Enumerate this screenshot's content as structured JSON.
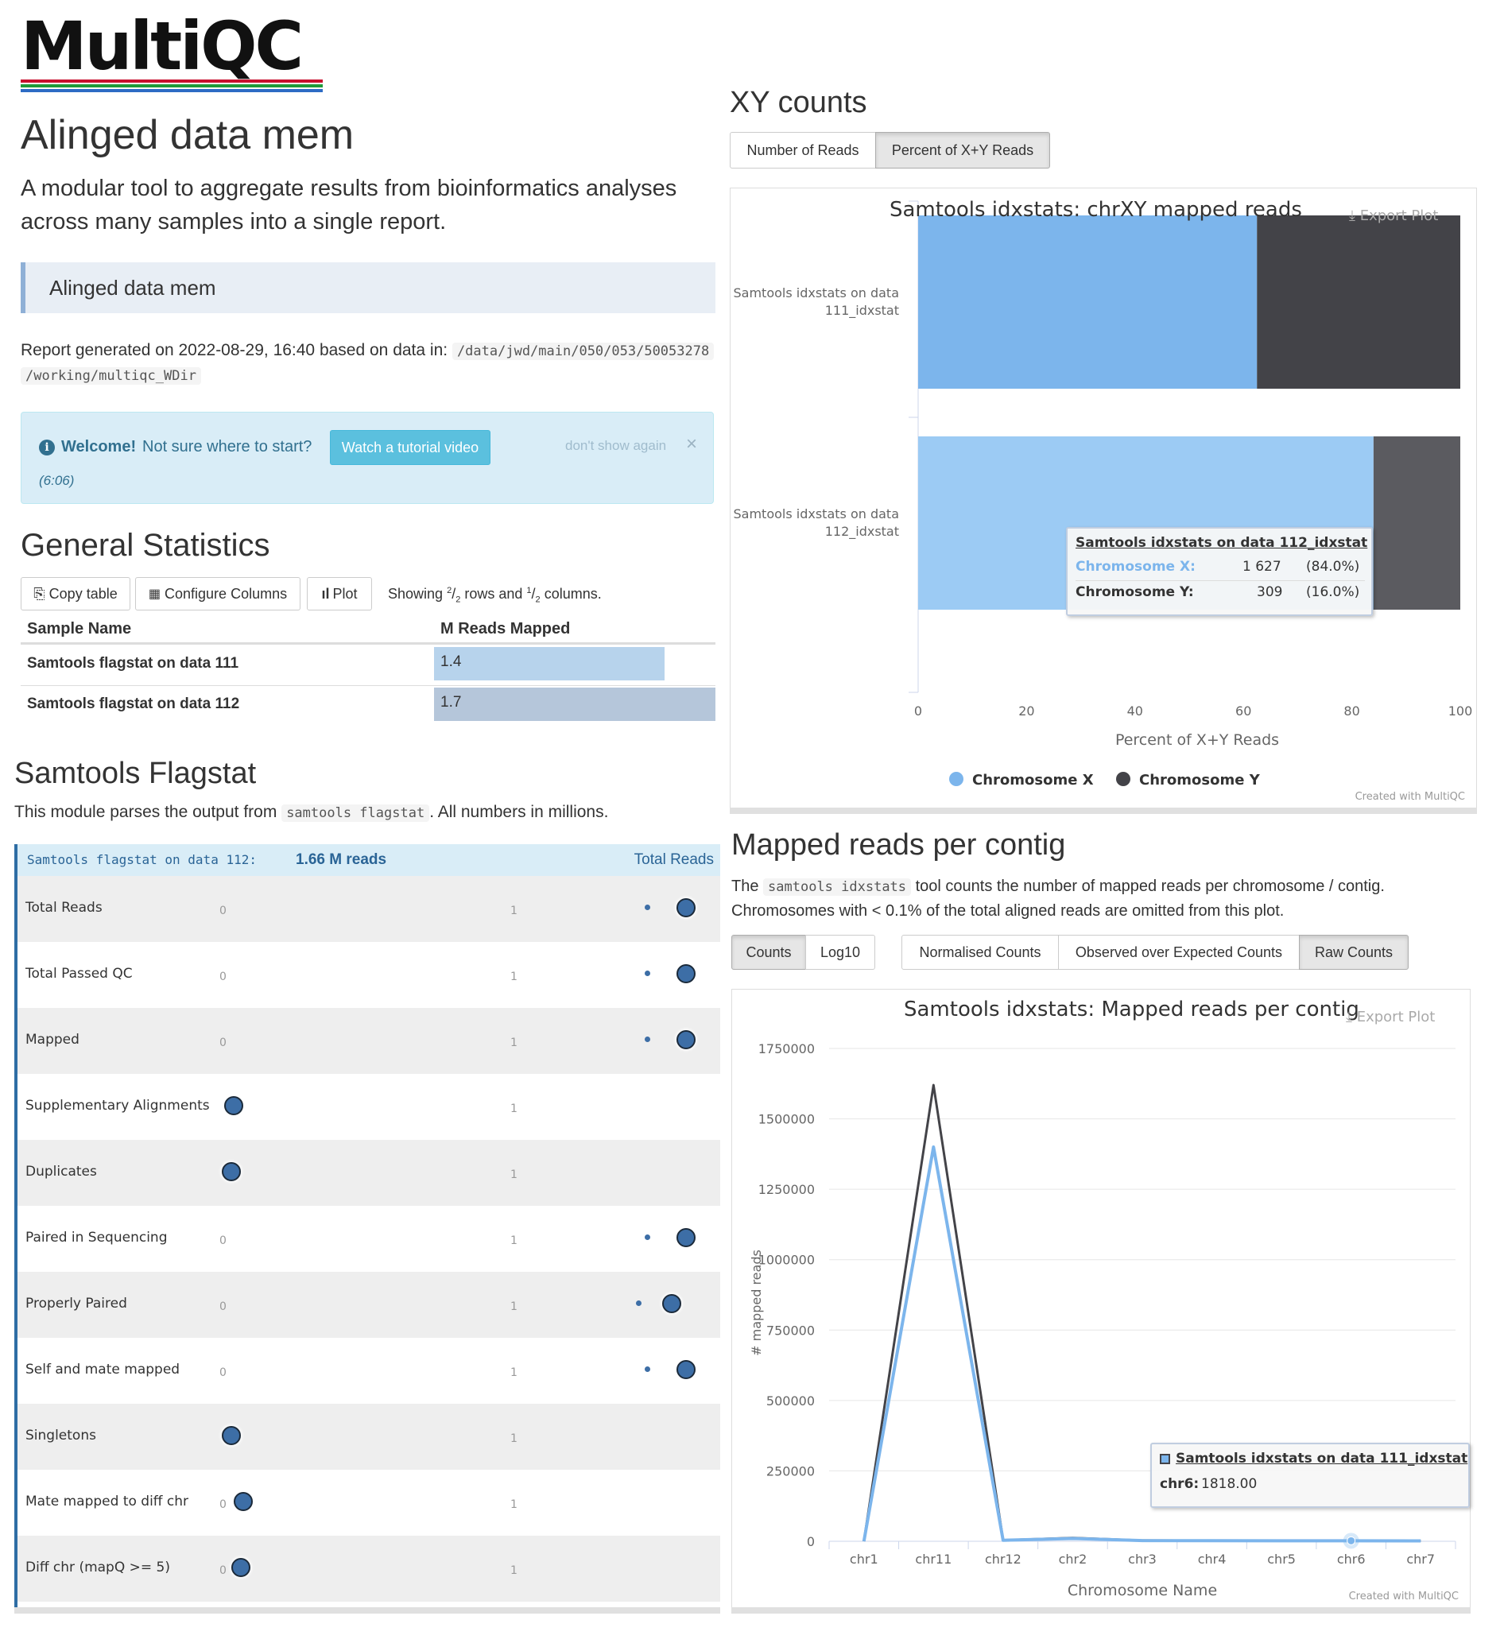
{
  "logo": {
    "text": "MultiQC"
  },
  "report": {
    "title": "Alinged data mem",
    "lead": "A modular tool to aggregate results from bioinformatics analyses across many samples into a single report.",
    "comment": "Alinged data mem",
    "generated_prefix": "Report generated on 2022-08-29, 16:40 based on data in:",
    "path_line1": "/data/jwd/main/050/053/50053278",
    "path_line2": "/working/multiqc_WDir"
  },
  "welcome": {
    "strong": "Welcome!",
    "text": "Not sure where to start?",
    "button": "Watch a tutorial video",
    "duration": "(6:06)",
    "dismiss": "don't show again",
    "close": "×"
  },
  "general_stats": {
    "title": "General Statistics",
    "buttons": {
      "copy": "Copy table",
      "configure": "Configure Columns",
      "plot": "Plot"
    },
    "showing": {
      "pre": "Showing",
      "rows_num": "2",
      "rows_den": "2",
      "mid": "rows and",
      "cols_num": "1",
      "cols_den": "2",
      "post": "columns."
    },
    "columns": [
      "Sample Name",
      "M Reads Mapped"
    ],
    "rows": [
      {
        "name": "Samtools flagstat on data 111",
        "value": "1.4",
        "fraction": 0.82
      },
      {
        "name": "Samtools flagstat on data 112",
        "value": "1.7",
        "fraction": 1.0
      }
    ]
  },
  "flagstat": {
    "title": "Samtools Flagstat",
    "desc_pre": "This module parses the output from",
    "desc_code": "samtools flagstat",
    "desc_post": ". All numbers in millions.",
    "header_sample": "Samtools flagstat on data 112:",
    "header_value": "1.66 M reads",
    "header_right": "Total Reads",
    "rows": [
      {
        "label": "Total Reads",
        "small_x": 0.88,
        "big_x": 0.96,
        "show0": true
      },
      {
        "label": "Total Passed QC",
        "small_x": 0.88,
        "big_x": 0.96,
        "show0": true
      },
      {
        "label": "Mapped",
        "small_x": 0.88,
        "big_x": 0.96,
        "show0": true
      },
      {
        "label": "Supplementary Alignments",
        "small_x": null,
        "big_x": 0.005,
        "show0": false
      },
      {
        "label": "Duplicates",
        "small_x": null,
        "big_x": 0.0,
        "show0": false
      },
      {
        "label": "Paired in Sequencing",
        "small_x": 0.88,
        "big_x": 0.96,
        "show0": true
      },
      {
        "label": "Properly Paired",
        "small_x": 0.86,
        "big_x": 0.93,
        "show0": true
      },
      {
        "label": "Self and mate mapped",
        "small_x": 0.88,
        "big_x": 0.96,
        "show0": true
      },
      {
        "label": "Singletons",
        "small_x": null,
        "big_x": 0.0,
        "show0": false
      },
      {
        "label": "Mate mapped to diff chr",
        "small_x": null,
        "big_x": 0.025,
        "show0": true
      },
      {
        "label": "Diff chr (mapQ >= 5)",
        "small_x": null,
        "big_x": 0.02,
        "show0": true
      }
    ],
    "tick0": "0",
    "tick1": "1"
  },
  "xy": {
    "title": "XY counts",
    "tabs": [
      "Number of Reads",
      "Percent of X+Y Reads"
    ],
    "active_tab": 1,
    "export": "Export Plot",
    "credit": "Created with MultiQC",
    "tooltip": {
      "title": "Samtools idxstats on data 112_idxstat",
      "rows": [
        {
          "label": "Chromosome X:",
          "count": "1 627",
          "pct": "(84.0%)"
        },
        {
          "label": "Chromosome Y:",
          "count": "309",
          "pct": "(16.0%)"
        }
      ]
    }
  },
  "contig": {
    "title": "Mapped reads per contig",
    "desc_pre": "The",
    "desc_code": "samtools idxstats",
    "desc_post": "tool counts the number of mapped reads per chromosome / contig.",
    "desc_line2": "Chromosomes with < 0.1% of the total aligned reads are omitted from this plot.",
    "buttons_a": [
      "Counts",
      "Log10"
    ],
    "buttons_b": [
      "Normalised Counts",
      "Observed over Expected Counts",
      "Raw Counts"
    ],
    "export": "Export Plot",
    "credit": "Created with MultiQC",
    "tooltip": {
      "title": "Samtools idxstats on data 111_idxstat",
      "label": "chr6:",
      "value": "1818.00"
    }
  },
  "colors": {
    "chrX": "#7cb5ec",
    "chrX_light": "#9ccbf4",
    "chrY": "#434348",
    "chrY_light": "#5b5b60",
    "gs_bar1": "#b7d3ec",
    "gs_bar2": "#b5c6da",
    "dot": "#3d6ea6"
  },
  "chart_data": [
    {
      "type": "bar",
      "title": "Samtools idxstats: chrXY mapped reads",
      "xlabel": "Percent of X+Y Reads",
      "orientation": "horizontal",
      "stacked": true,
      "categories": [
        "Samtools idxstats on data 111_idxstat",
        "Samtools idxstats on data 112_idxstat"
      ],
      "category_lines": [
        [
          "Samtools idxstats on data",
          "111_idxstat"
        ],
        [
          "Samtools idxstats on data",
          "112_idxstat"
        ]
      ],
      "series": [
        {
          "name": "Chromosome X",
          "values": [
            62.5,
            84.0
          ]
        },
        {
          "name": "Chromosome Y",
          "values": [
            37.5,
            16.0
          ]
        }
      ],
      "xlim": [
        0,
        100
      ],
      "ticks": [
        0,
        20,
        40,
        60,
        80,
        100
      ],
      "legend": "bottom"
    },
    {
      "type": "line",
      "title": "Samtools idxstats: Mapped reads per contig",
      "xlabel": "Chromosome Name",
      "ylabel": "# mapped reads",
      "categories": [
        "chr1",
        "chr11",
        "chr12",
        "chr2",
        "chr3",
        "chr4",
        "chr5",
        "chr6",
        "chr7"
      ],
      "series": [
        {
          "name": "Samtools idxstats on data 112_idxstat",
          "values": [
            0,
            1620000,
            4000,
            12000,
            3000,
            2500,
            2000,
            2200,
            1500
          ]
        },
        {
          "name": "Samtools idxstats on data 111_idxstat",
          "values": [
            0,
            1400000,
            3500,
            10000,
            2500,
            2000,
            1800,
            1818,
            1300
          ]
        }
      ],
      "ylim": [
        0,
        1750000
      ],
      "yticks": [
        0,
        250000,
        500000,
        750000,
        1000000,
        1250000,
        1500000,
        1750000
      ],
      "grid": true
    }
  ]
}
